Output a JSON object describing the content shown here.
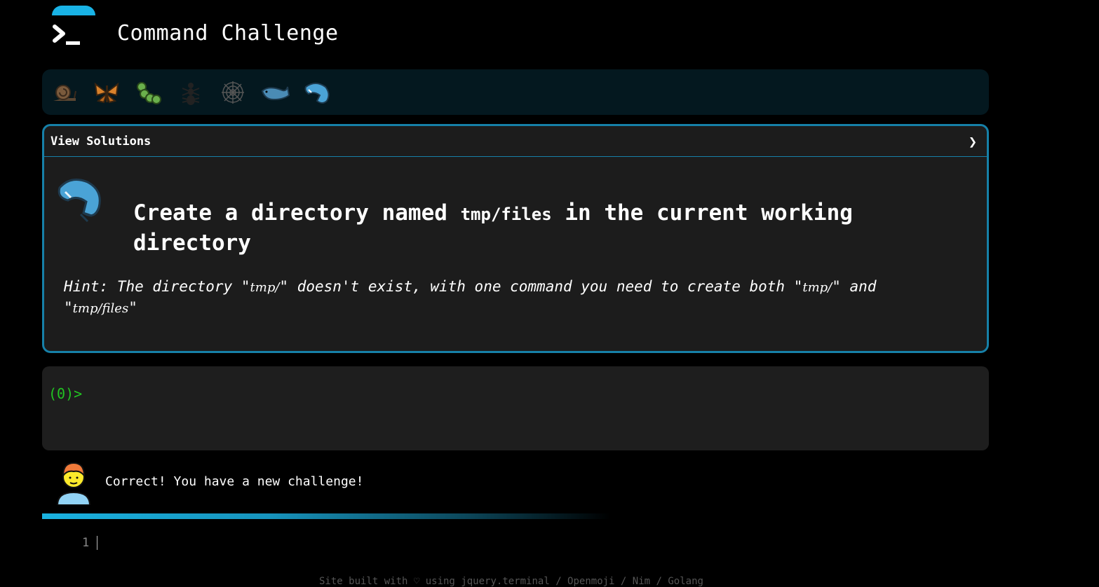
{
  "app": {
    "title": "Command Challenge",
    "logo_icon": "terminal-prompt-icon",
    "accent_color": "#19b3e6"
  },
  "emoji_bar": {
    "items": [
      {
        "name": "snail-icon"
      },
      {
        "name": "butterfly-icon"
      },
      {
        "name": "caterpillar-icon"
      },
      {
        "name": "ant-icon"
      },
      {
        "name": "spider-web-icon"
      },
      {
        "name": "whale-icon"
      },
      {
        "name": "spouting-whale-icon",
        "active": true
      }
    ]
  },
  "solutions": {
    "label": "View Solutions",
    "expand_icon": "chevron-right-icon"
  },
  "challenge": {
    "icon": "spouting-whale-icon",
    "title_before": "Create a directory named",
    "title_code": "tmp/files",
    "title_after": "in the current working directory",
    "hint_prefix": "Hint: The directory \"",
    "hint_code1": "tmp/",
    "hint_mid": "\" doesn't exist, with one command you need to create both \"",
    "hint_code2": "tmp/",
    "hint_and": "\" and \"",
    "hint_code3": "tmp/files",
    "hint_end": "\""
  },
  "terminal": {
    "prompt": "(0)>",
    "prompt_color": "#22c322"
  },
  "feedback": {
    "avatar_icon": "man-avatar-icon",
    "message": "Correct! You have a new challenge!"
  },
  "editor": {
    "line_number": "1"
  },
  "footer": {
    "text": "Site built with ♡ using",
    "links": [
      "jquery.terminal",
      "Openmoji",
      "Nim",
      "Golang"
    ],
    "separator": " / "
  }
}
